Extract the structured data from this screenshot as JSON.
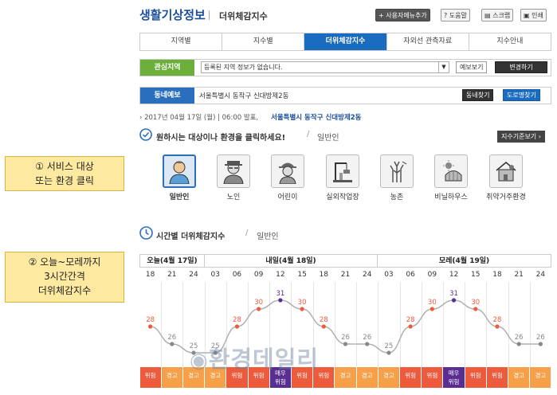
{
  "callouts": [
    {
      "line1": "① 서비스 대상",
      "line2": "또는 환경 클릭"
    },
    {
      "line1": "② 오늘~모레까지",
      "line2": "3시간간격",
      "line3": "더위체감지수"
    }
  ],
  "header": {
    "title": "생활기상정보",
    "subtitle": "더위체감지수",
    "buttons": [
      "+ 사용자메뉴추가",
      "? 도움말",
      "스크랩",
      "인쇄"
    ]
  },
  "tabs": [
    "지역별",
    "지수별",
    "더위체감지수",
    "자외선 관측자료",
    "지수안내"
  ],
  "active_tab": 2,
  "region": {
    "label": "관심지역",
    "select_value": "등록된 지역 정보가 없습니다.",
    "view_button": "예보보기",
    "change_button": "변경하기"
  },
  "neighborhood": {
    "label": "동네예보",
    "location": "서울특별시 동작구 신대방제2동",
    "find_button": "동네찾기",
    "road_button": "도로명찾기"
  },
  "announce": {
    "date": "› 2017년 04월 17일 (월) | 06:00 발표,",
    "location": "서울특별시 동작구 신대방제2동"
  },
  "section1": {
    "title": "원하시는 대상이나 환경을 클릭하세요!",
    "sub": "일반인",
    "index_button": "지수기준보기 ›"
  },
  "targets": [
    {
      "label": "일반인",
      "icon": "person-icon"
    },
    {
      "label": "노인",
      "icon": "elderly-icon"
    },
    {
      "label": "어린이",
      "icon": "child-icon"
    },
    {
      "label": "실외작업장",
      "icon": "construction-icon"
    },
    {
      "label": "농촌",
      "icon": "farm-icon"
    },
    {
      "label": "비닐하우스",
      "icon": "greenhouse-icon"
    },
    {
      "label": "취약거주환경",
      "icon": "house-icon"
    }
  ],
  "section2": {
    "title": "시간별 더위체감지수",
    "sub": "일반인"
  },
  "days": [
    "오늘(4월 17일)",
    "내일(4월 18일)",
    "모레(4월 19일)"
  ],
  "hours": [
    "18",
    "21",
    "24",
    "03",
    "06",
    "09",
    "12",
    "15",
    "18",
    "21",
    "24",
    "03",
    "06",
    "09",
    "12",
    "15",
    "18",
    "21",
    "24"
  ],
  "chart_data": {
    "type": "line",
    "x": [
      "18",
      "21",
      "24",
      "03",
      "06",
      "09",
      "12",
      "15",
      "18",
      "21",
      "24",
      "03",
      "06",
      "09",
      "12",
      "15",
      "18",
      "21",
      "24"
    ],
    "values": [
      28,
      26,
      25,
      25,
      28,
      30,
      31,
      30,
      28,
      26,
      26,
      25,
      28,
      30,
      31,
      30,
      28,
      26,
      26
    ],
    "levels": [
      "위험",
      "경고",
      "경고",
      "경고",
      "위험",
      "위험",
      "매우위험",
      "위험",
      "위험",
      "경고",
      "경고",
      "경고",
      "위험",
      "위험",
      "매우위험",
      "위험",
      "위험",
      "경고",
      "경고"
    ],
    "ylim": [
      24,
      32
    ]
  },
  "colors": {
    "경고": "#f6a04a",
    "위험": "#ee5a3c",
    "매우위험": "#5a2d91",
    "line": "#b0b0b0"
  },
  "watermark": "환경데일리"
}
